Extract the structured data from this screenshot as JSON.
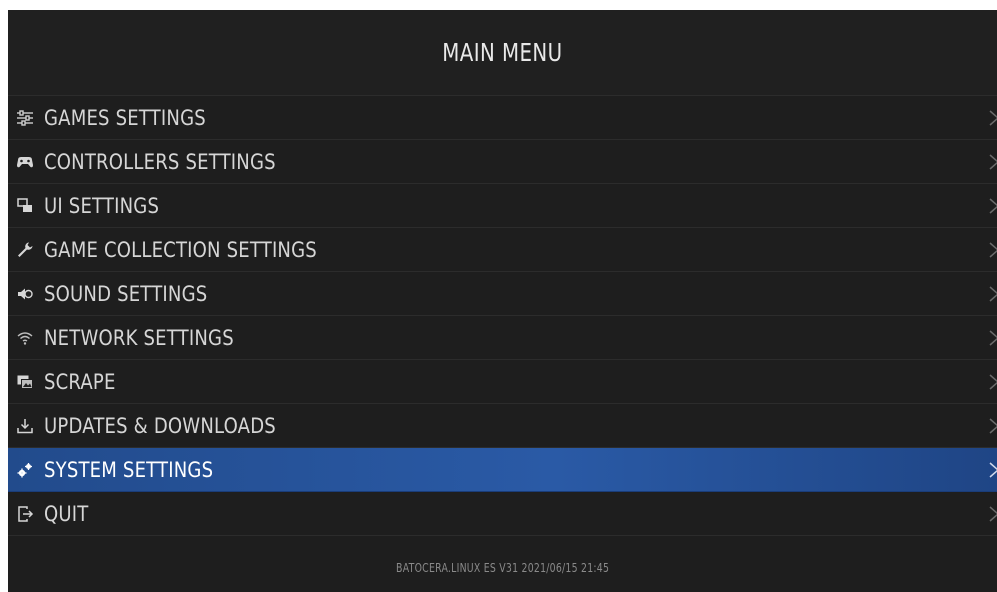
{
  "header": {
    "title": "MAIN MENU"
  },
  "menu": {
    "items": [
      {
        "label": "GAMES SETTINGS",
        "icon": "sliders-icon"
      },
      {
        "label": "CONTROLLERS SETTINGS",
        "icon": "gamepad-icon"
      },
      {
        "label": "UI SETTINGS",
        "icon": "display-icon"
      },
      {
        "label": "GAME COLLECTION SETTINGS",
        "icon": "wrench-icon"
      },
      {
        "label": "SOUND SETTINGS",
        "icon": "speaker-icon"
      },
      {
        "label": "NETWORK SETTINGS",
        "icon": "wifi-icon"
      },
      {
        "label": "SCRAPE",
        "icon": "image-icon"
      },
      {
        "label": "UPDATES & DOWNLOADS",
        "icon": "download-icon"
      },
      {
        "label": "SYSTEM SETTINGS",
        "icon": "gears-icon",
        "selected": true
      },
      {
        "label": "QUIT",
        "icon": "exit-icon"
      }
    ]
  },
  "footer": {
    "version": "BATOCERA.LINUX ES V31 2021/06/15 21:45"
  },
  "colors": {
    "background": "#1e1e1e",
    "selected_start": "#224b8c",
    "selected_end": "#2a5aa6",
    "text": "#d6d6d6",
    "footer_text": "#8a8a8a"
  }
}
